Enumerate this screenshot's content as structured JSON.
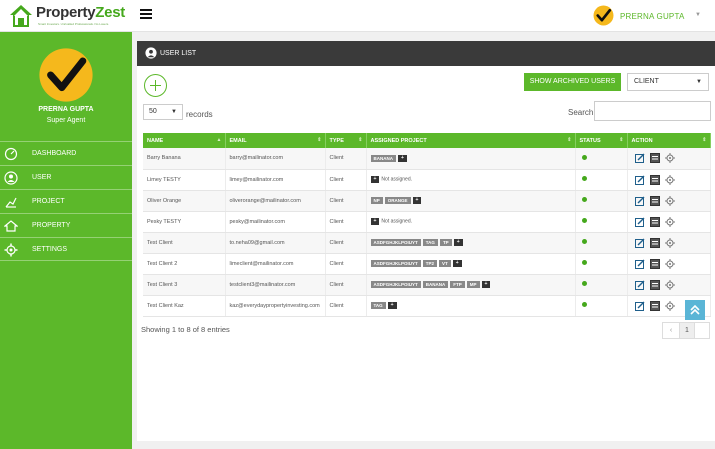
{
  "brand": {
    "name_part1": "Property",
    "name_part2": "Zest",
    "tagline": "Smart Investors. Unrivalled Professionals. No Losers."
  },
  "header": {
    "user_name": "PRERNA GUPTA",
    "caret": "▼"
  },
  "sidebar": {
    "user_name": "PRERNA GUPTA",
    "user_role": "Super Agent",
    "items": [
      {
        "label": "DASHBOARD",
        "icon": "dashboard-icon"
      },
      {
        "label": "USER",
        "icon": "user-icon"
      },
      {
        "label": "PROJECT",
        "icon": "project-icon"
      },
      {
        "label": "PROPERTY",
        "icon": "property-icon"
      },
      {
        "label": "SETTINGS",
        "icon": "settings-icon"
      }
    ]
  },
  "panel": {
    "title": "USER LIST",
    "archived_button": "SHOW ARCHIVED USERS",
    "filter_select": "CLIENT",
    "page_length": "50",
    "page_length_label": "records",
    "search_label": "Search:",
    "search_value": ""
  },
  "table": {
    "columns": [
      "NAME",
      "EMAIL",
      "TYPE",
      "ASSIGNED PROJECT",
      "STATUS",
      "ACTION"
    ],
    "not_assigned_text": "Not assigned.",
    "plus": "+",
    "rows": [
      {
        "name": "Barry Banana",
        "email": "barry@mailinator.com",
        "type": "Client",
        "tags": [
          "BANANA"
        ],
        "assigned": true
      },
      {
        "name": "Limey TESTY",
        "email": "limey@mailinator.com",
        "type": "Client",
        "tags": [],
        "assigned": false
      },
      {
        "name": "Oliver Orange",
        "email": "oliverorange@mailinator.com",
        "type": "Client",
        "tags": [
          "NP",
          "ORANGE"
        ],
        "assigned": true
      },
      {
        "name": "Pesky TESTY",
        "email": "pesky@mailinator.com",
        "type": "Client",
        "tags": [],
        "assigned": false
      },
      {
        "name": "Test Client",
        "email": "to.neha09@gmail.com",
        "type": "Client",
        "tags": [
          "ASDFGHJKLPOIUYT",
          "TAG",
          "TP"
        ],
        "assigned": true
      },
      {
        "name": "Test Client 2",
        "email": "limeclient@mailinator.com",
        "type": "Client",
        "tags": [
          "ASDFGHJKLPOIUYT",
          "TP2",
          "VT"
        ],
        "assigned": true
      },
      {
        "name": "Test Client 3",
        "email": "testclient3@mailinator.com",
        "type": "Client",
        "tags": [
          "ASDFGHJKLPOIUYT",
          "BANANA",
          "FTP",
          "MP"
        ],
        "assigned": true
      },
      {
        "name": "Test Client Kaz",
        "email": "kaz@everydaypropertyinvesting.com",
        "type": "Client",
        "tags": [
          "TAG"
        ],
        "assigned": true
      }
    ]
  },
  "footer": {
    "info": "Showing 1 to 8 of 8 entries",
    "prev": "‹",
    "page": "1"
  },
  "colors": {
    "green": "#5cb82a",
    "dark": "#3a3a3a",
    "accent_blue": "#5ab5d6"
  }
}
